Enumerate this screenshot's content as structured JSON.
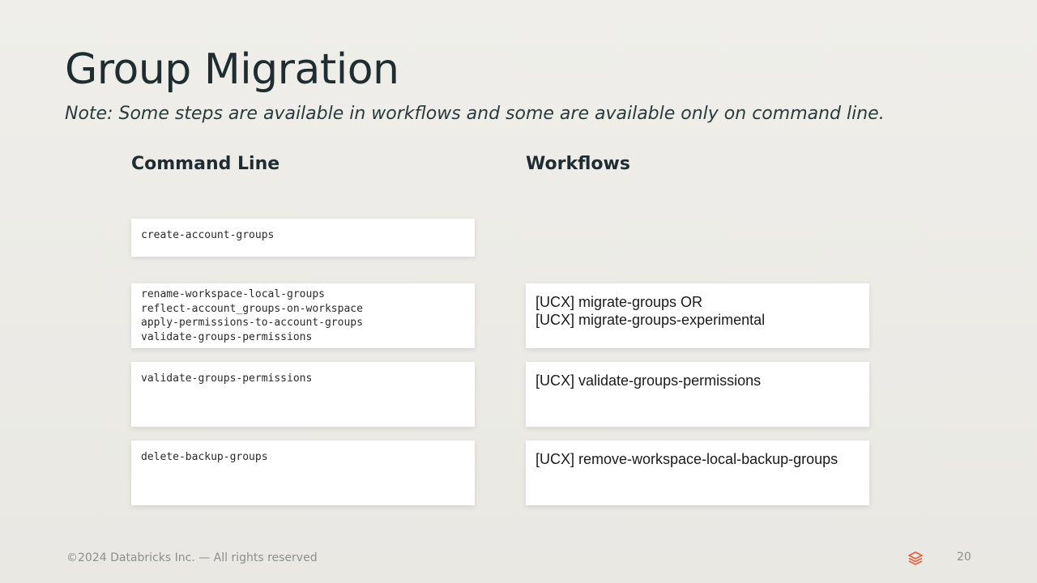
{
  "slide": {
    "title": "Group Migration",
    "note": "Note: Some steps are available in workflows and some are available only on command line."
  },
  "columns": {
    "command_line_heading": "Command Line",
    "workflows_heading": "Workflows"
  },
  "command_line_cards": [
    {
      "lines": [
        "create-account-groups"
      ]
    },
    {
      "lines": [
        "rename-workspace-local-groups",
        "reflect-account_groups-on-workspace",
        "apply-permissions-to-account-groups",
        "validate-groups-permissions"
      ]
    },
    {
      "lines": [
        "validate-groups-permissions"
      ]
    },
    {
      "lines": [
        "delete-backup-groups"
      ]
    }
  ],
  "workflow_cards": [
    {
      "lines": [
        "[UCX] migrate-groups OR",
        "[UCX] migrate-groups-experimental"
      ]
    },
    {
      "lines": [
        "[UCX] validate-groups-permissions"
      ]
    },
    {
      "lines": [
        "[UCX] remove-workspace-local-backup-groups"
      ]
    }
  ],
  "footer": {
    "copyright": "©2024 Databricks Inc. — All rights reserved",
    "page_number": "20",
    "logo_icon": "databricks-logo-icon",
    "logo_color": "#e8603c"
  }
}
